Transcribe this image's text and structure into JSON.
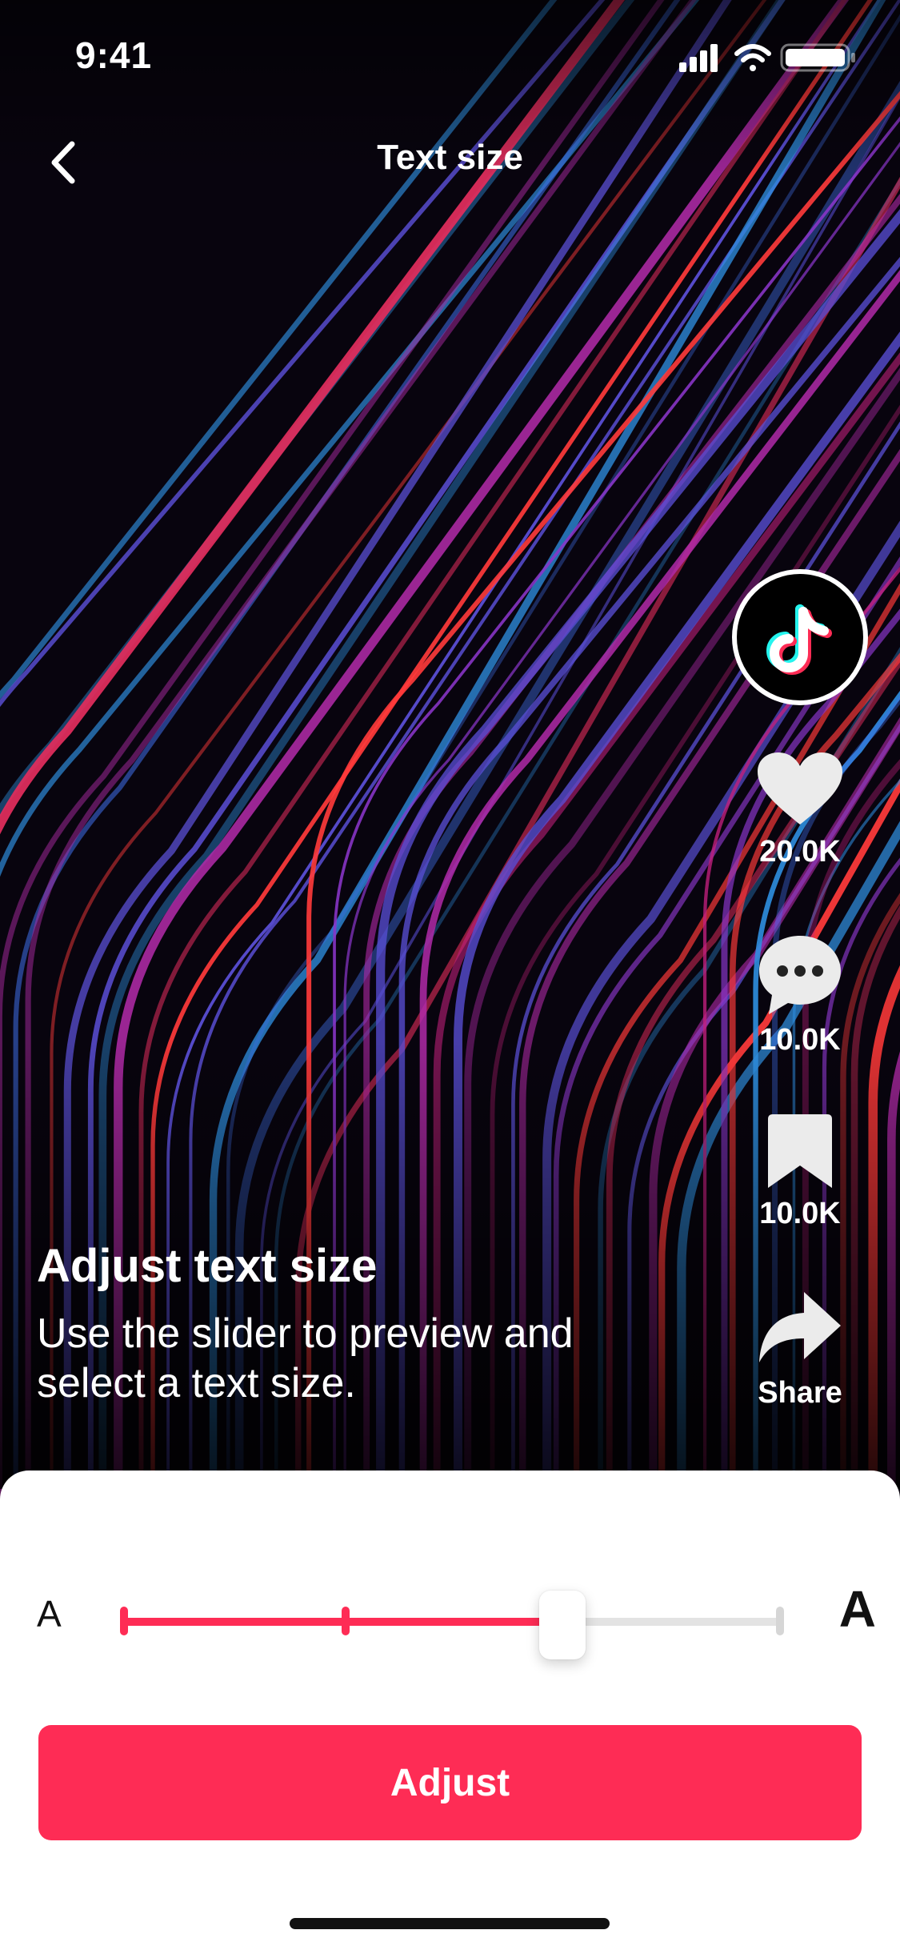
{
  "status_bar": {
    "time": "9:41"
  },
  "header": {
    "title": "Text size"
  },
  "sidebar": {
    "likes": "20.0K",
    "comments": "10.0K",
    "saves": "10.0K",
    "share_label": "Share"
  },
  "caption": {
    "title": "Adjust text size",
    "body": "Use the slider to preview and select a text size."
  },
  "sheet": {
    "small_a": "A",
    "large_a": "A",
    "slider": {
      "steps": 4,
      "selected_step": 3
    },
    "button_label": "Adjust"
  },
  "colors": {
    "accent": "#fe2c55",
    "track": "#e3e3e3"
  },
  "icons": [
    "back-arrow-icon",
    "signal-icon",
    "wifi-icon",
    "battery-icon",
    "tiktok-logo-icon",
    "heart-icon",
    "comment-icon",
    "bookmark-icon",
    "share-icon"
  ]
}
